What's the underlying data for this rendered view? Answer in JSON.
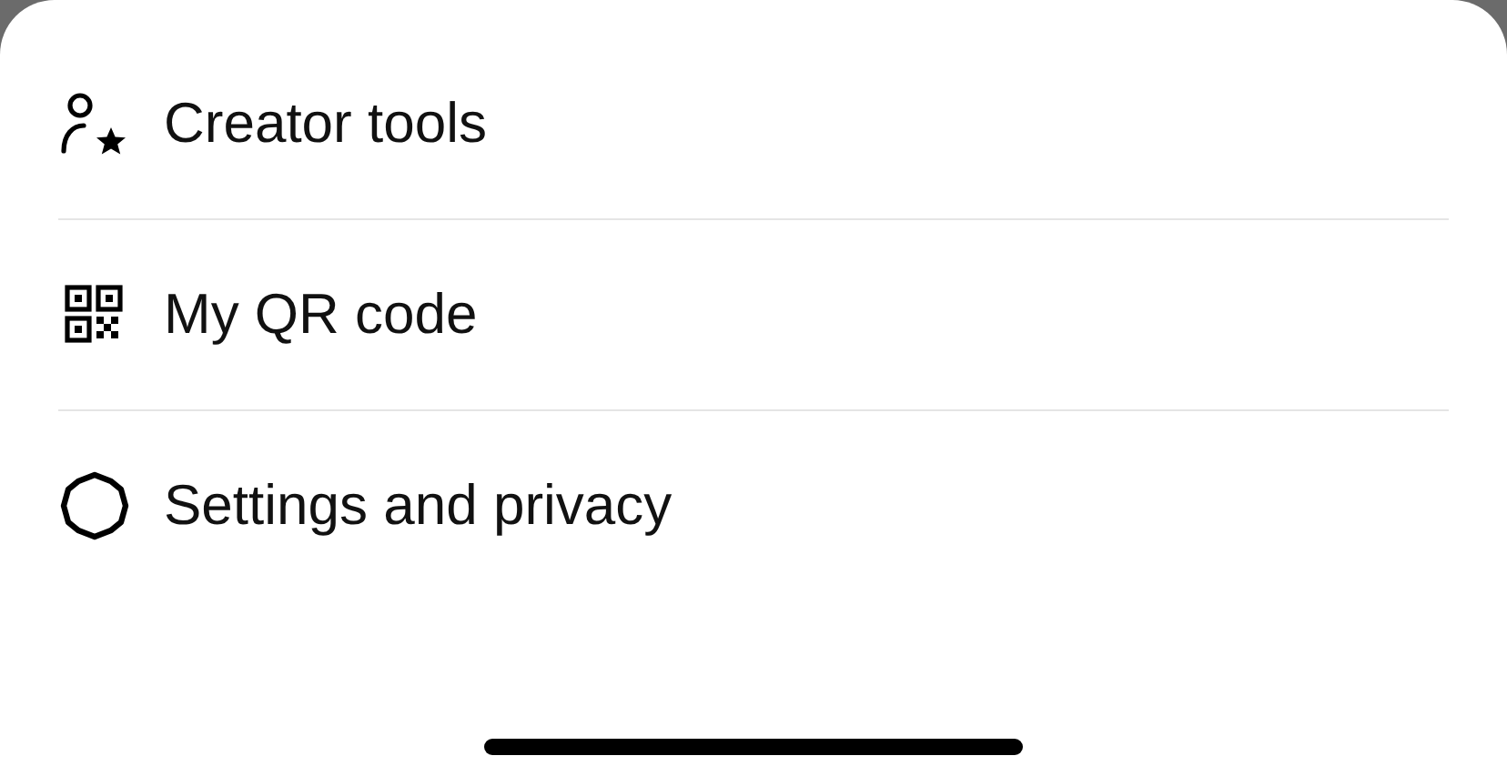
{
  "menu": {
    "items": [
      {
        "kind": "creator",
        "label": "Creator tools"
      },
      {
        "kind": "qr",
        "label": "My QR code"
      },
      {
        "kind": "settings",
        "label": "Settings and privacy"
      }
    ]
  }
}
